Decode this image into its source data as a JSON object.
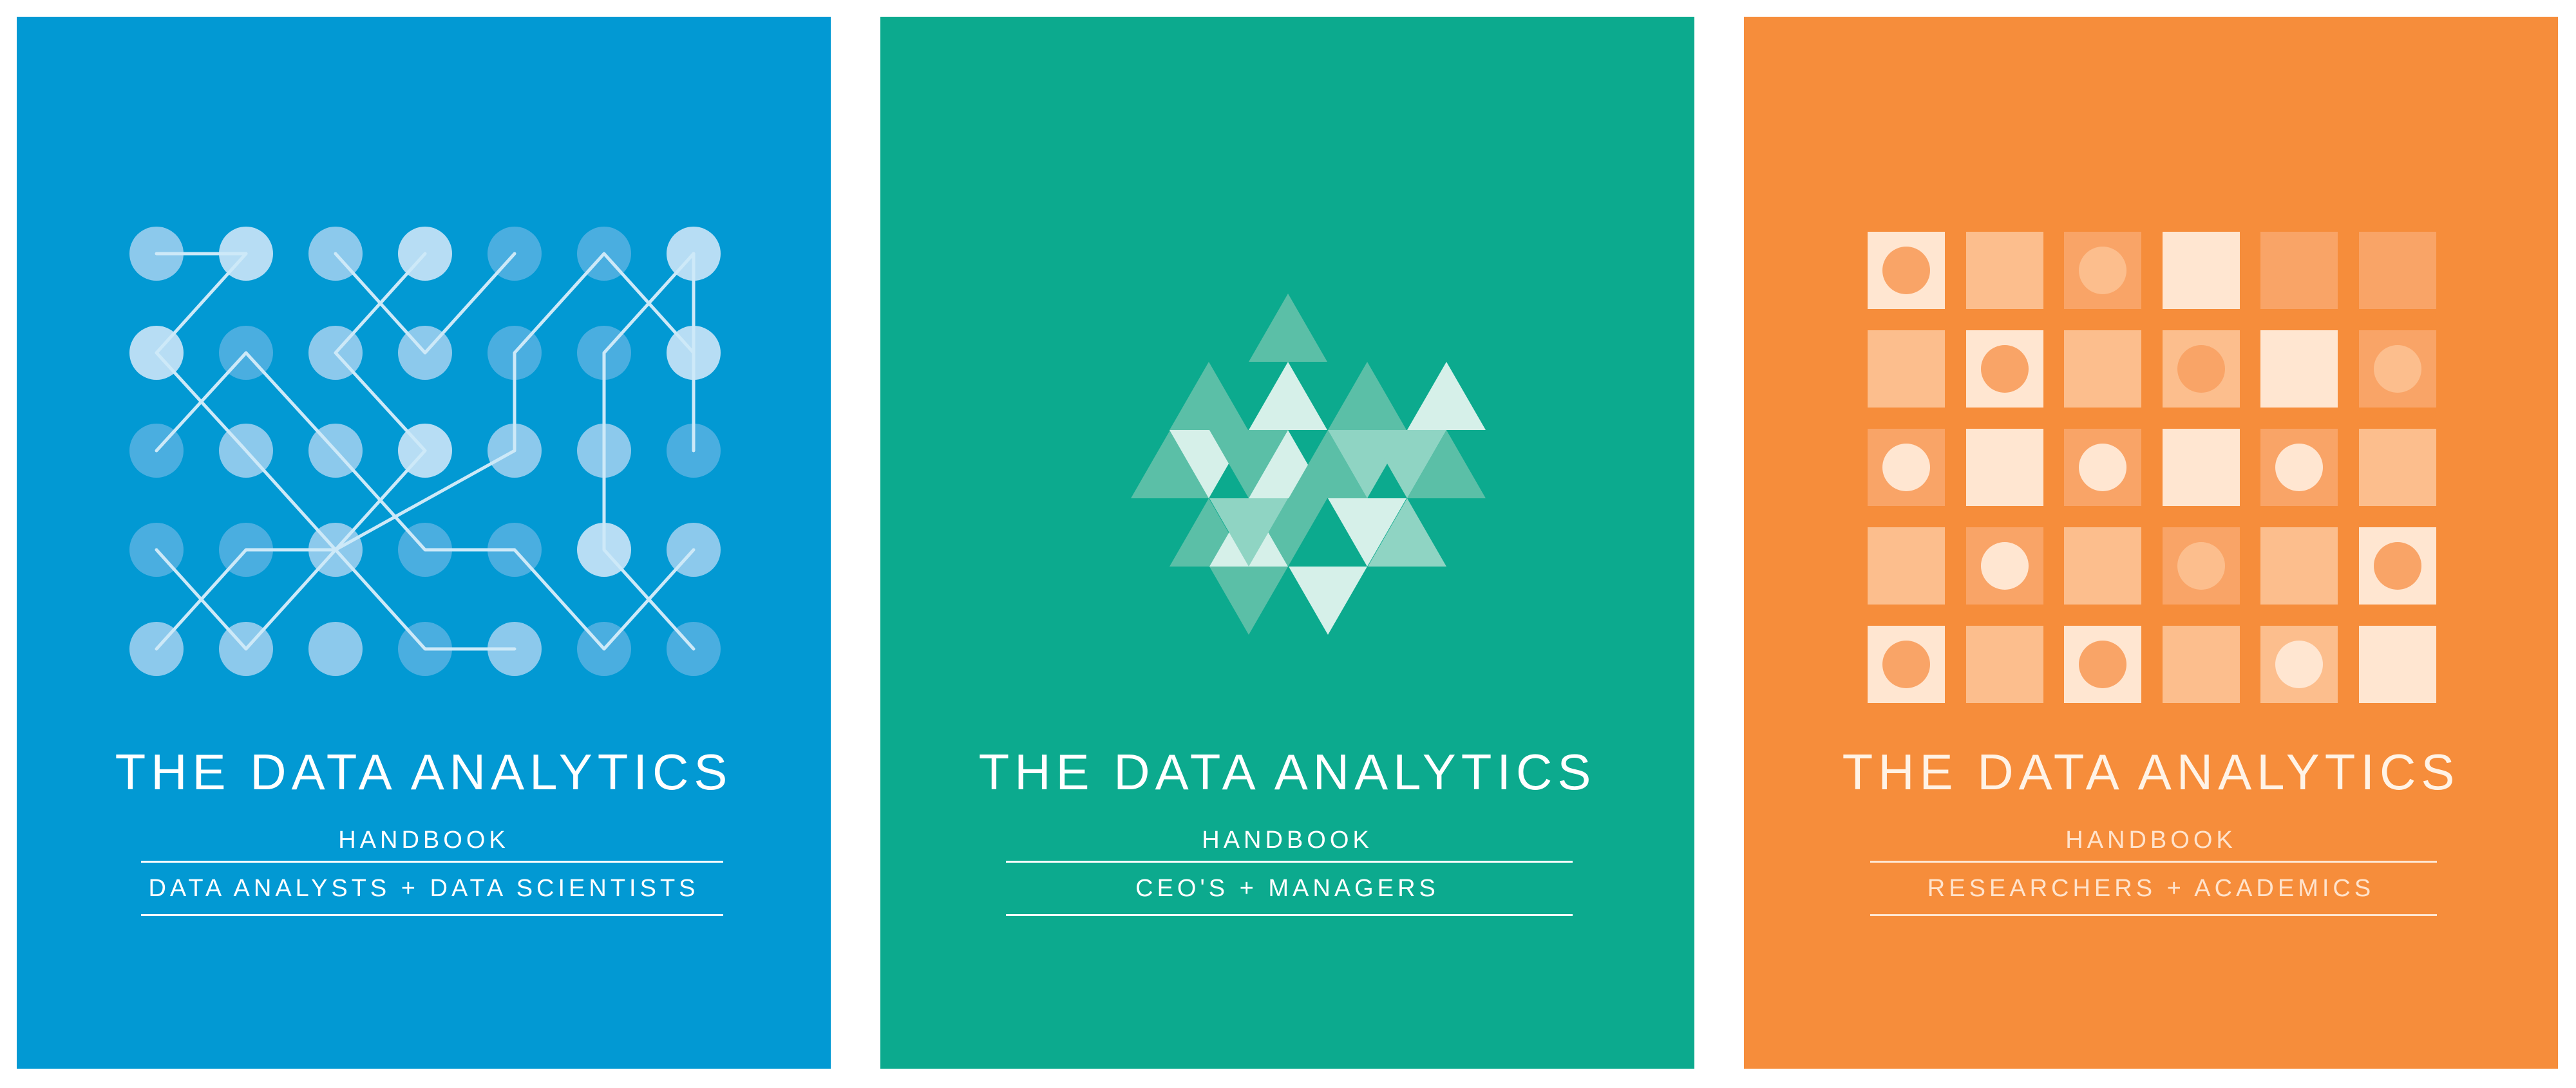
{
  "covers": [
    {
      "title": "THE DATA ANALYTICS",
      "subtitle": "HANDBOOK",
      "audience": "DATA ANALYSTS + DATA SCIENTISTS",
      "background_color": "#0299D3",
      "text_color": "#ffffff",
      "rule_color": "#ffffff"
    },
    {
      "title": "THE DATA ANALYTICS",
      "subtitle": "HANDBOOK",
      "audience": "CEO'S + MANAGERS",
      "background_color": "#0CAA8E",
      "text_color": "#ffffff",
      "rule_color": "#ffffff"
    },
    {
      "title": "THE DATA ANALYTICS",
      "subtitle": "HANDBOOK",
      "audience": "RESEARCHERS + ACADEMICS",
      "background_color": "#F68D3B",
      "text_color": "#FFF3E6",
      "rule_color": "#FFE8D4"
    }
  ]
}
